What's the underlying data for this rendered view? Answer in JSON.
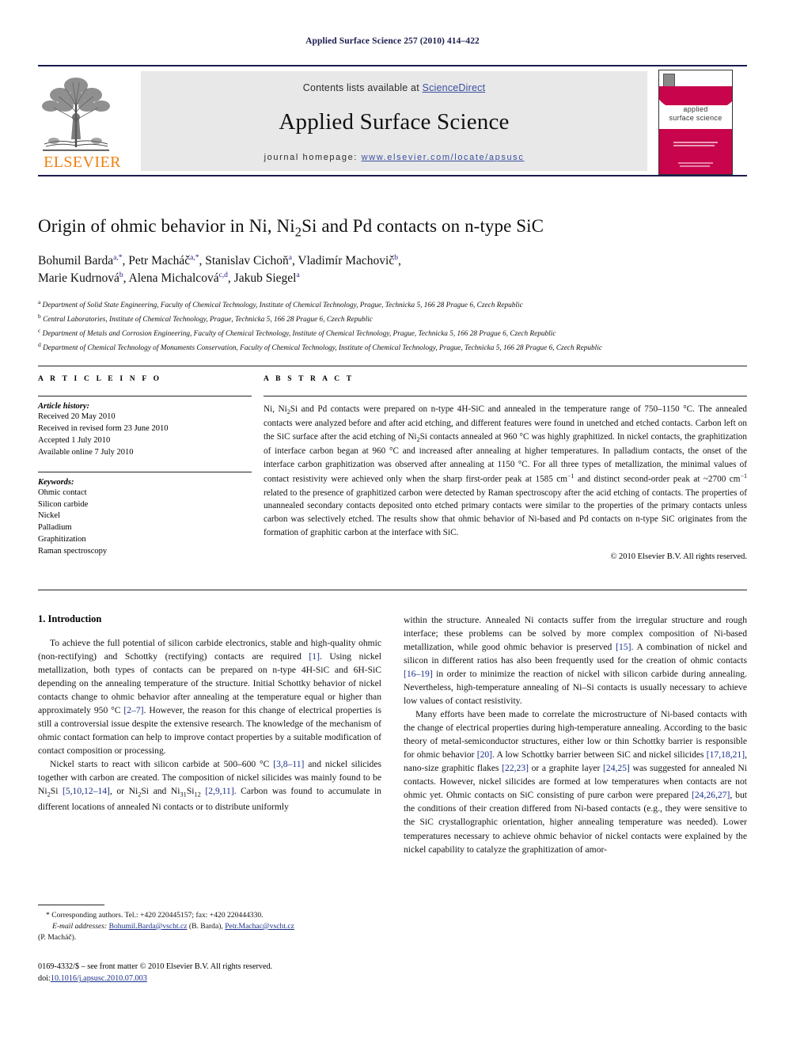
{
  "running_head": "Applied Surface Science 257 (2010) 414–422",
  "masthead": {
    "publisher_name": "ELSEVIER",
    "contents_prefix": "Contents lists available at ",
    "sciencedirect": "ScienceDirect",
    "journal_title": "Applied Surface Science",
    "homepage_label": "journal homepage:",
    "homepage_url": "www.elsevier.com/locate/apsusc",
    "cover_title_line1": "applied",
    "cover_title_line2": "surface science",
    "cover_color": "#C8054C",
    "link_color": "#3a4fa0"
  },
  "article": {
    "title": "Origin of ohmic behavior in Ni, Ni2Si and Pd contacts on n-type SiC",
    "authors_line1": "Bohumil Barda",
    "authors_line1_sup1": "a,*",
    "authors_line1_b": ", Petr Macháč",
    "authors_line1_sup2": "a,*",
    "authors_line1_c": ", Stanislav Cichoň",
    "authors_line1_sup3": "a",
    "authors_line1_d": ", Vladimír Machovič",
    "authors_line1_sup4": "b",
    "authors_line1_e": ",",
    "authors_line2": "Marie Kudrnová",
    "authors_line2_sup1": "b",
    "authors_line2_b": ", Alena Michalcová",
    "authors_line2_sup2": "c,d",
    "authors_line2_c": ", Jakub Siegel",
    "authors_line2_sup3": "a",
    "affiliations": [
      {
        "mark": "a",
        "text": "Department of Solid State Engineering, Faculty of Chemical Technology, Institute of Chemical Technology, Prague, Technicka 5, 166 28 Prague 6, Czech Republic"
      },
      {
        "mark": "b",
        "text": "Central Laboratories, Institute of Chemical Technology, Prague, Technicka 5, 166 28 Prague 6, Czech Republic"
      },
      {
        "mark": "c",
        "text": "Department of Metals and Corrosion Engineering, Faculty of Chemical Technology, Institute of Chemical Technology, Prague, Technicka 5, 166 28 Prague 6, Czech Republic"
      },
      {
        "mark": "d",
        "text": "Department of Chemical Technology of Monuments Conservation, Faculty of Chemical Technology, Institute of Chemical Technology, Prague, Technicka 5, 166 28 Prague 6, Czech Republic"
      }
    ]
  },
  "article_info": {
    "heading": "A R T I C L E   I N F O",
    "history_label": "Article history:",
    "history": [
      "Received 20 May 2010",
      "Received in revised form 23 June 2010",
      "Accepted 1 July 2010",
      "Available online 7 July 2010"
    ],
    "keywords_label": "Keywords:",
    "keywords": [
      "Ohmic contact",
      "Silicon carbide",
      "Nickel",
      "Palladium",
      "Graphitization",
      "Raman spectroscopy"
    ]
  },
  "abstract": {
    "heading": "A B S T R A C T",
    "copyright": "© 2010 Elsevier B.V. All rights reserved."
  },
  "body": {
    "section1_heading": "1.  Introduction"
  },
  "footnotes": {
    "corresponding": "* Corresponding authors. Tel.: +420 220445157; fax: +420 220444330.",
    "email_label": "E-mail addresses:",
    "email1": "Bohumil.Barda@vscht.cz",
    "email1_person": "(B. Barda),",
    "email2": "Petr.Machac@vscht.cz",
    "email2_person": "(P. Macháč)."
  },
  "imprint": {
    "line1": "0169-4332/$ – see front matter © 2010 Elsevier B.V. All rights reserved.",
    "doi_label": "doi:",
    "doi_value": "10.1016/j.apsusc.2010.07.003"
  }
}
